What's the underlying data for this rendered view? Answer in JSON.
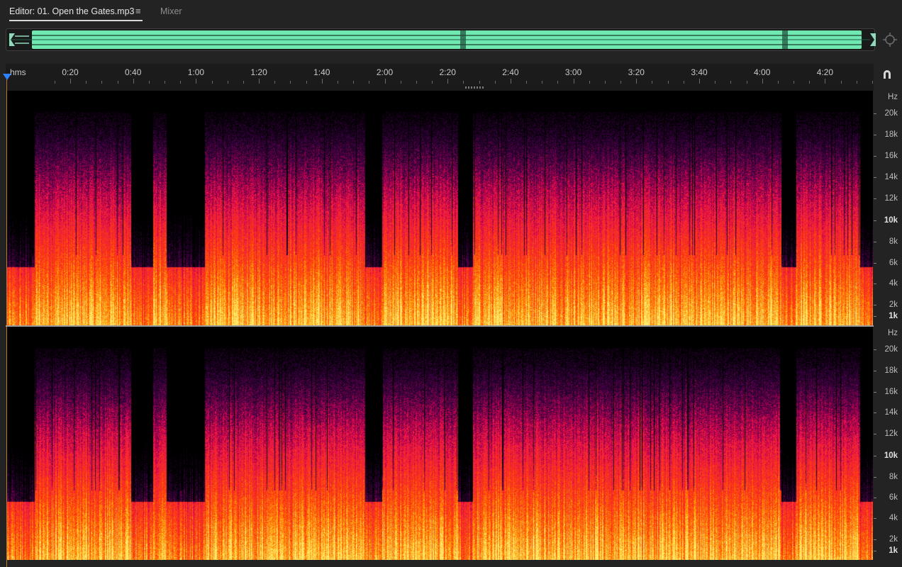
{
  "tabs": {
    "editor_label": "Editor: 01. Open the Gates.mp3",
    "menu_glyph": "≡",
    "mixer_label": "Mixer"
  },
  "overview": {
    "waveform_color": "#6fe8b1",
    "zoom_icon": "zoom-navigator-icon"
  },
  "ruler": {
    "unit": "hms",
    "ticks": [
      "0:20",
      "0:40",
      "1:00",
      "1:20",
      "1:40",
      "2:00",
      "2:20",
      "2:40",
      "3:00",
      "3:20",
      "3:40",
      "4:00",
      "4:20"
    ],
    "snap_icon": "magnet-icon"
  },
  "channels": [
    {
      "id": "left",
      "axis_unit": "Hz",
      "labels": [
        "20k",
        "18k",
        "16k",
        "14k",
        "12k",
        "10k",
        "8k",
        "6k",
        "4k",
        "2k",
        "1k"
      ]
    },
    {
      "id": "right",
      "axis_unit": "Hz",
      "labels": [
        "20k",
        "18k",
        "16k",
        "14k",
        "12k",
        "10k",
        "8k",
        "6k",
        "4k",
        "2k",
        "1k"
      ]
    }
  ],
  "colors": {
    "playhead": "#2f82ff",
    "spectrum_low": "#ffe27a",
    "spectrum_mid": "#ff3a0a",
    "spectrum_high": "#7a0f7a"
  }
}
